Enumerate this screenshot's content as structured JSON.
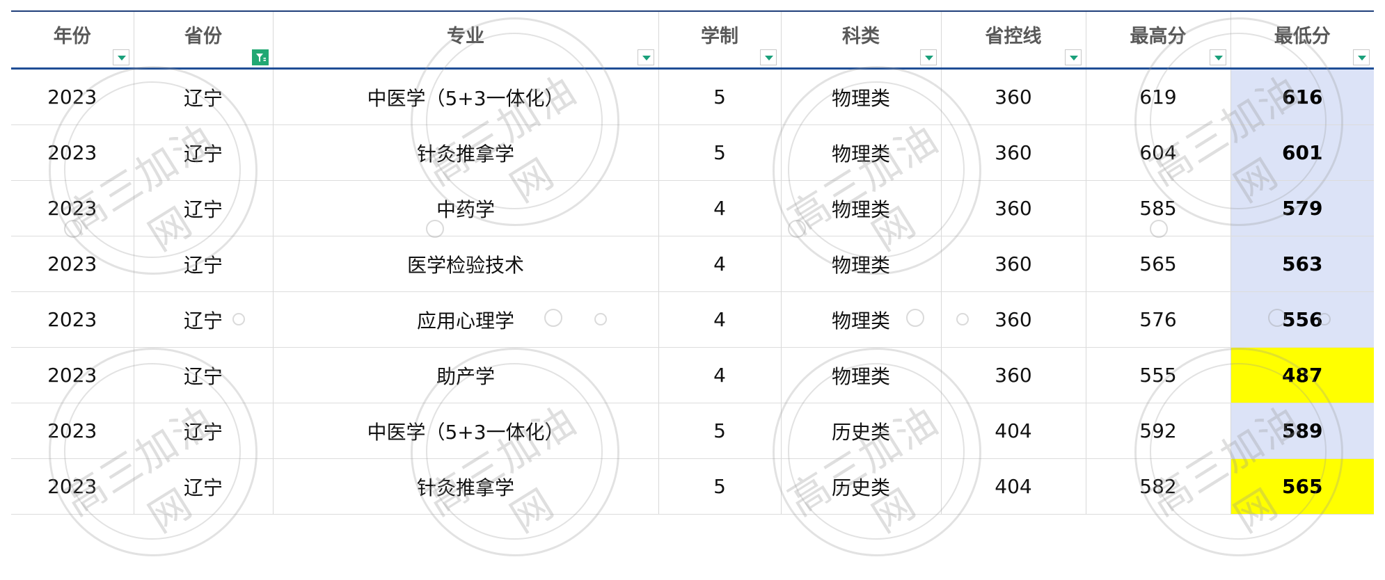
{
  "table": {
    "columns": [
      "年份",
      "省份",
      "专业",
      "学制",
      "科类",
      "省控线",
      "最高分",
      "最低分"
    ],
    "rows": [
      {
        "year": "2023",
        "province": "辽宁",
        "major": "中医学（5+3一体化）",
        "duration": "5",
        "category": "物理类",
        "control_line": "360",
        "max_score": "619",
        "min_score": "616",
        "highlight": false
      },
      {
        "year": "2023",
        "province": "辽宁",
        "major": "针灸推拿学",
        "duration": "5",
        "category": "物理类",
        "control_line": "360",
        "max_score": "604",
        "min_score": "601",
        "highlight": false
      },
      {
        "year": "2023",
        "province": "辽宁",
        "major": "中药学",
        "duration": "4",
        "category": "物理类",
        "control_line": "360",
        "max_score": "585",
        "min_score": "579",
        "highlight": false
      },
      {
        "year": "2023",
        "province": "辽宁",
        "major": "医学检验技术",
        "duration": "4",
        "category": "物理类",
        "control_line": "360",
        "max_score": "565",
        "min_score": "563",
        "highlight": false
      },
      {
        "year": "2023",
        "province": "辽宁",
        "major": "应用心理学",
        "duration": "4",
        "category": "物理类",
        "control_line": "360",
        "max_score": "576",
        "min_score": "556",
        "highlight": false
      },
      {
        "year": "2023",
        "province": "辽宁",
        "major": "助产学",
        "duration": "4",
        "category": "物理类",
        "control_line": "360",
        "max_score": "555",
        "min_score": "487",
        "highlight": true
      },
      {
        "year": "2023",
        "province": "辽宁",
        "major": "中医学（5+3一体化）",
        "duration": "5",
        "category": "历史类",
        "control_line": "404",
        "max_score": "592",
        "min_score": "589",
        "highlight": false
      },
      {
        "year": "2023",
        "province": "辽宁",
        "major": "针灸推拿学",
        "duration": "5",
        "category": "历史类",
        "control_line": "404",
        "max_score": "582",
        "min_score": "565",
        "highlight": true
      }
    ],
    "active_filter_column": "省份"
  },
  "watermark": {
    "text": "高三加油网"
  },
  "colors": {
    "header_rule": "#1f4e96",
    "min_column_bg": "#dce3f7",
    "highlight_yellow": "#ffff00",
    "filter_active": "#21a873",
    "filter_arrow": "#1aa07a"
  },
  "icons": {
    "filter": "chevron-down-icon",
    "active_filter": "funnel-icon"
  }
}
